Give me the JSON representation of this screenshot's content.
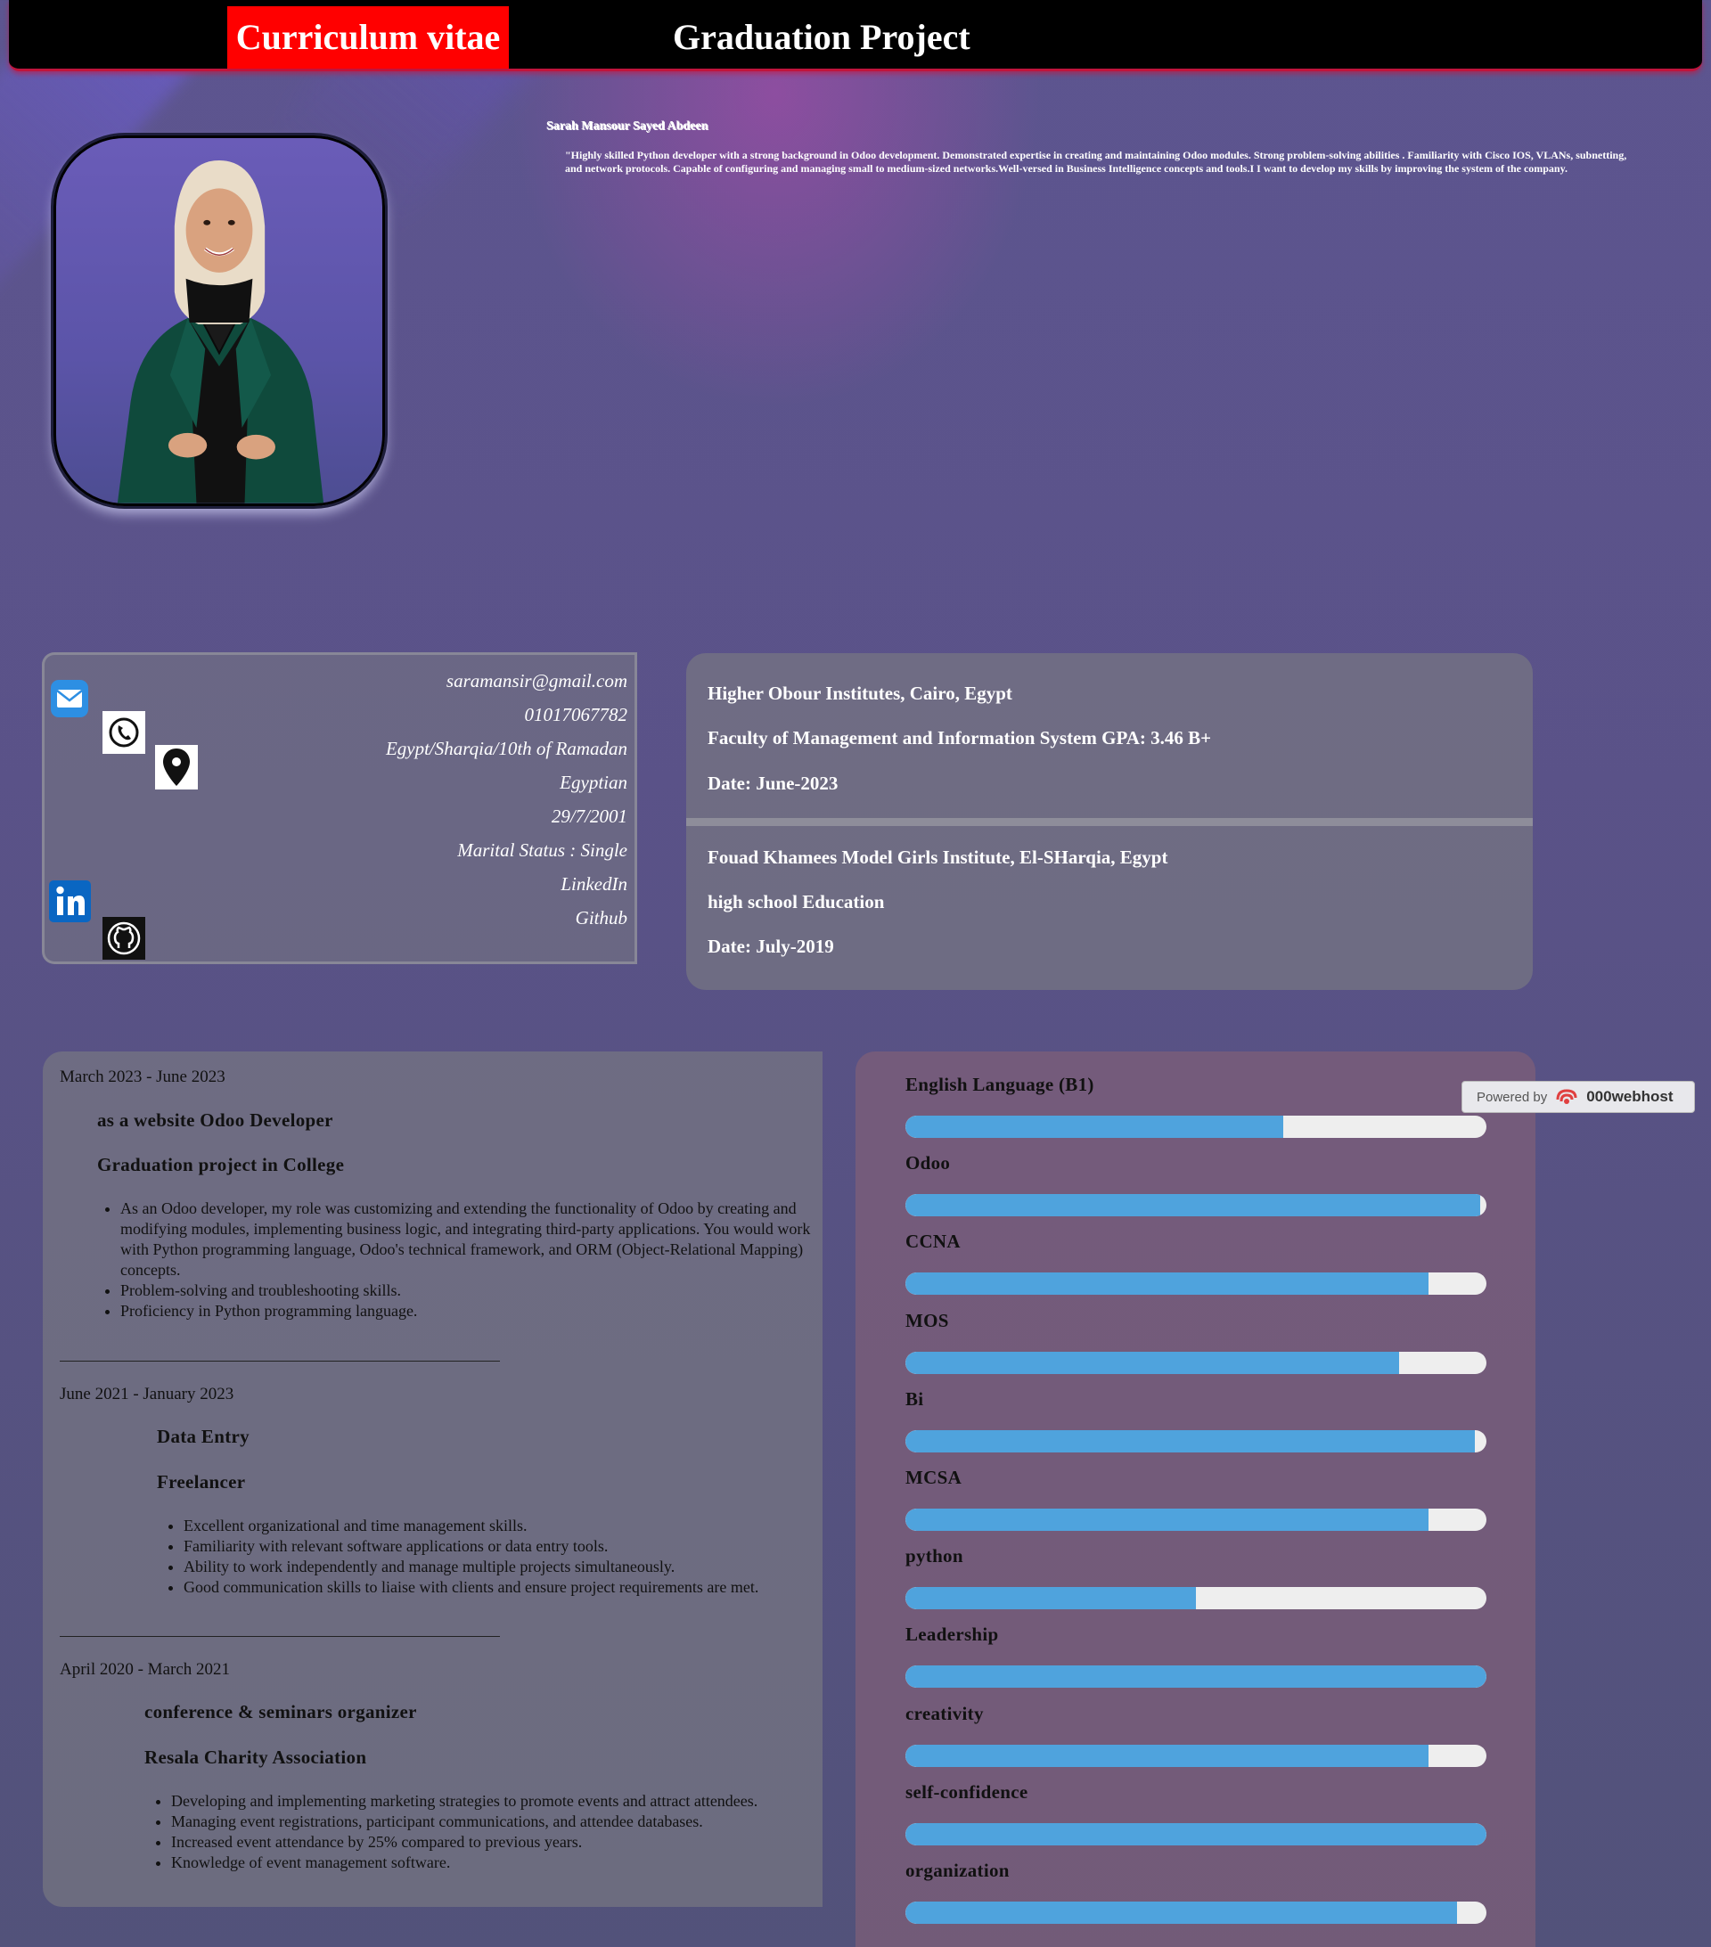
{
  "header": {
    "cv_title": "Curriculum vitae",
    "project_title": "Graduation Project"
  },
  "profile": {
    "name": "Sarah Mansour Sayed Abdeen",
    "summary": "\"Highly skilled Python developer with a strong background in Odoo development. Demonstrated expertise in creating and maintaining Odoo modules. Strong problem-solving abilities . Familiarity with Cisco IOS, VLANs, subnetting, and network protocols. Capable of configuring and managing small to medium-sized networks.Well-versed in Business Intelligence concepts and tools.I I want to develop my skills by improving the system of the company."
  },
  "contact": {
    "email": "saramansir@gmail.com",
    "phone": "01017067782",
    "address": "Egypt/Sharqia/10th of Ramadan",
    "nationality": "Egyptian",
    "birthdate": "29/7/2001",
    "marital": "Marital Status : Single",
    "linkedin": "LinkedIn",
    "github": "Github"
  },
  "education": [
    {
      "institution": "Higher Obour Institutes, Cairo, Egypt",
      "detail": "Faculty of Management and Information System GPA: 3.46 B+",
      "date": "Date: June-2023"
    },
    {
      "institution": "Fouad Khamees Model Girls Institute, El-SHarqia, Egypt",
      "detail": "high school Education",
      "date": "Date: July-2019"
    }
  ],
  "experience": [
    {
      "date": "March 2023 - June 2023",
      "role": "as a website Odoo Developer",
      "org": "Graduation project in College",
      "bullets": [
        "As an Odoo developer, my role was customizing and extending the functionality of Odoo by creating and modifying modules, implementing business logic, and integrating third-party applications. You would work with Python programming language, Odoo's technical framework, and ORM (Object-Relational Mapping) concepts.",
        "Problem-solving and troubleshooting skills.",
        "Proficiency in Python programming language."
      ]
    },
    {
      "date": "June 2021 - January 2023",
      "role": "Data Entry",
      "org": "Freelancer",
      "bullets": [
        "Excellent organizational and time management skills.",
        "Familiarity with relevant software applications or data entry tools.",
        "Ability to work independently and manage multiple projects simultaneously.",
        "Good communication skills to liaise with clients and ensure project requirements are met."
      ]
    },
    {
      "date": "April 2020 - March 2021",
      "role": "conference & seminars organizer",
      "org": "Resala Charity Association",
      "bullets": [
        "Developing and implementing marketing strategies to promote events and attract attendees.",
        "Managing event registrations, participant communications, and attendee databases.",
        "Increased event attendance by 25% compared to previous years.",
        "Knowledge of event management software."
      ]
    }
  ],
  "skills": [
    {
      "label": "English Language (B1)",
      "level": 65
    },
    {
      "label": "Odoo",
      "level": 99
    },
    {
      "label": "CCNA",
      "level": 90
    },
    {
      "label": "MOS",
      "level": 85
    },
    {
      "label": "Bi",
      "level": 98
    },
    {
      "label": "MCSA",
      "level": 90
    },
    {
      "label": "python",
      "level": 50
    },
    {
      "label": "Leadership",
      "level": 100
    },
    {
      "label": "creativity",
      "level": 90
    },
    {
      "label": "self-confidence",
      "level": 100
    },
    {
      "label": "organization",
      "level": 95
    }
  ],
  "powered": {
    "prefix": "Powered by",
    "brand": "000webhost"
  },
  "colors": {
    "accent_red": "#ff0000",
    "bar_blue": "#4fa3dd",
    "bar_track": "#eeeeee"
  },
  "icons": [
    "mail-icon",
    "phone-icon",
    "location-pin-icon",
    "linkedin-icon",
    "github-icon"
  ]
}
